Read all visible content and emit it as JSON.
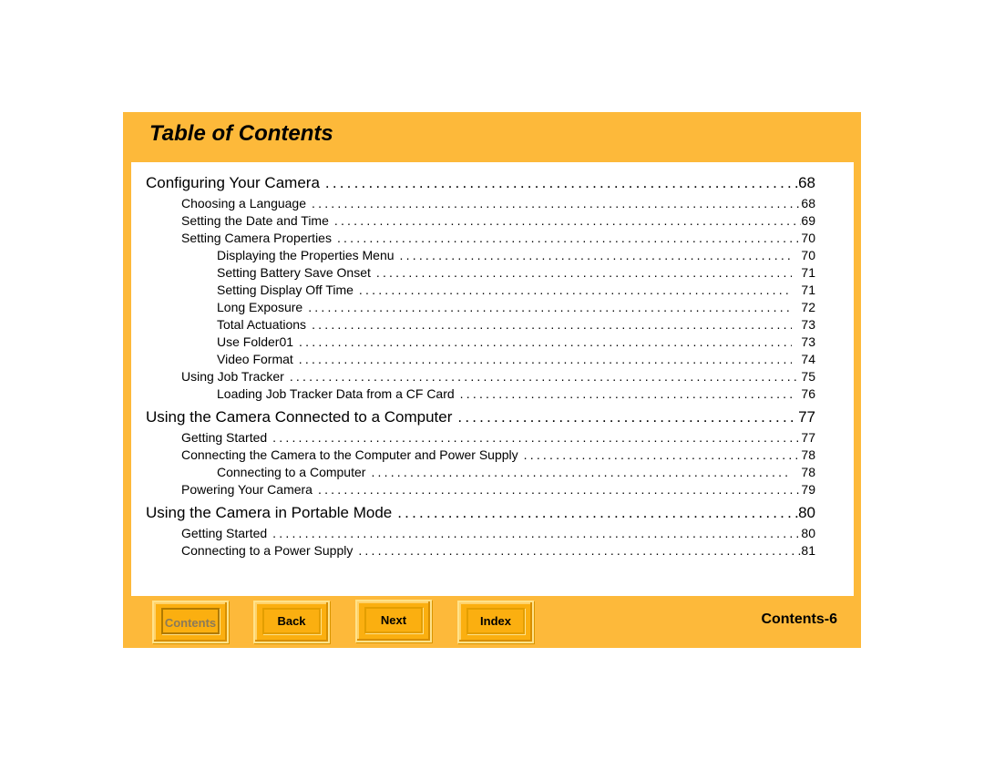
{
  "title": "Table of Contents",
  "colors": {
    "frame": "#FDB93A",
    "button": "#FBAF10",
    "content_bg": "#FFFFFF"
  },
  "entries": [
    {
      "level": 1,
      "label": "Configuring Your Camera",
      "page": "68"
    },
    {
      "level": 2,
      "label": "Choosing a Language",
      "page": "68"
    },
    {
      "level": 2,
      "label": "Setting the Date and Time",
      "page": "69"
    },
    {
      "level": 2,
      "label": "Setting Camera Properties",
      "page": "70"
    },
    {
      "level": 3,
      "label": "Displaying the Properties Menu",
      "page": "70"
    },
    {
      "level": 3,
      "label": "Setting Battery Save Onset",
      "page": "71"
    },
    {
      "level": 3,
      "label": "Setting Display Off Time",
      "page": "71"
    },
    {
      "level": 3,
      "label": "Long Exposure",
      "page": "72"
    },
    {
      "level": 3,
      "label": "Total Actuations",
      "page": "73"
    },
    {
      "level": 3,
      "label": "Use Folder01",
      "page": "73"
    },
    {
      "level": 3,
      "label": "Video Format",
      "page": "74"
    },
    {
      "level": 2,
      "label": "Using Job Tracker",
      "page": "75"
    },
    {
      "level": 3,
      "label": "Loading Job Tracker Data from a CF Card",
      "page": "76"
    },
    {
      "level": 1,
      "label": "Using the Camera Connected to a Computer",
      "page": "77"
    },
    {
      "level": 2,
      "label": "Getting Started",
      "page": "77"
    },
    {
      "level": 2,
      "label": "Connecting the Camera to the Computer and Power Supply",
      "page": "78"
    },
    {
      "level": 3,
      "label": "Connecting to a Computer",
      "page": "78"
    },
    {
      "level": 2,
      "label": "Powering Your Camera",
      "page": "79"
    },
    {
      "level": 1,
      "label": "Using the Camera in Portable Mode",
      "page": "80"
    },
    {
      "level": 2,
      "label": "Getting Started",
      "page": "80"
    },
    {
      "level": 2,
      "label": "Connecting to a Power Supply",
      "page": "81"
    }
  ],
  "nav": {
    "contents": "Contents",
    "back": "Back",
    "next": "Next",
    "index": "Index"
  },
  "page_label": "Contents-6"
}
